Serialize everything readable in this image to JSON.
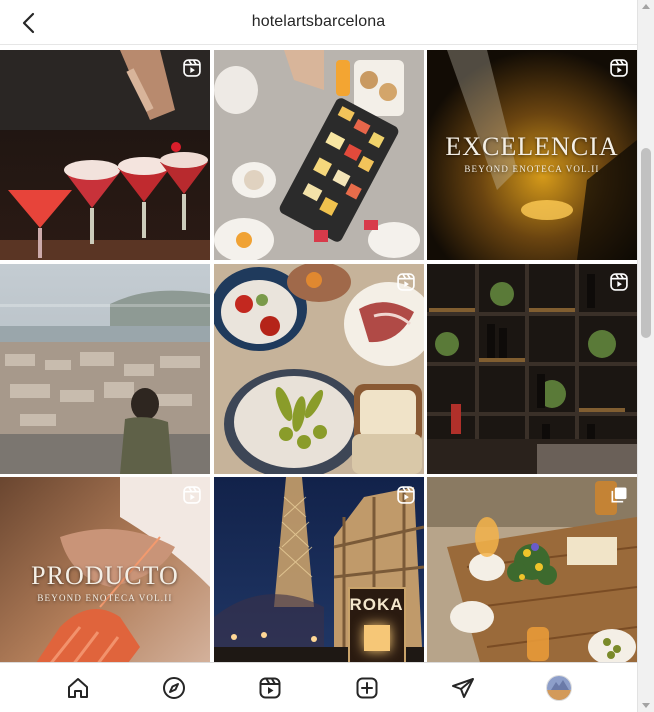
{
  "header": {
    "username": "hotelartsbarcelona",
    "back_icon": "chevron-left-icon"
  },
  "posts": [
    {
      "type": "reel",
      "overlay_title": "",
      "overlay_sub": ""
    },
    {
      "type": "photo",
      "overlay_title": "",
      "overlay_sub": ""
    },
    {
      "type": "reel",
      "overlay_title": "EXCELENCIA",
      "overlay_sub": "BEYOND ENOTECA VOL.II"
    },
    {
      "type": "photo",
      "overlay_title": "",
      "overlay_sub": ""
    },
    {
      "type": "reel",
      "overlay_title": "",
      "overlay_sub": ""
    },
    {
      "type": "reel",
      "overlay_title": "",
      "overlay_sub": ""
    },
    {
      "type": "reel",
      "overlay_title": "PRODUCTO",
      "overlay_sub": "BEYOND ENOTECA VOL.II"
    },
    {
      "type": "reel",
      "overlay_title": "",
      "overlay_sub": "",
      "sign": "ROKA"
    },
    {
      "type": "multi",
      "overlay_title": "",
      "overlay_sub": ""
    }
  ],
  "nav": {
    "items": [
      "home-icon",
      "explore-icon",
      "reels-icon",
      "create-icon",
      "direct-icon",
      "profile-avatar"
    ]
  },
  "colors": {
    "text": "#262626",
    "border": "#dbdbdb",
    "background": "#ffffff"
  }
}
